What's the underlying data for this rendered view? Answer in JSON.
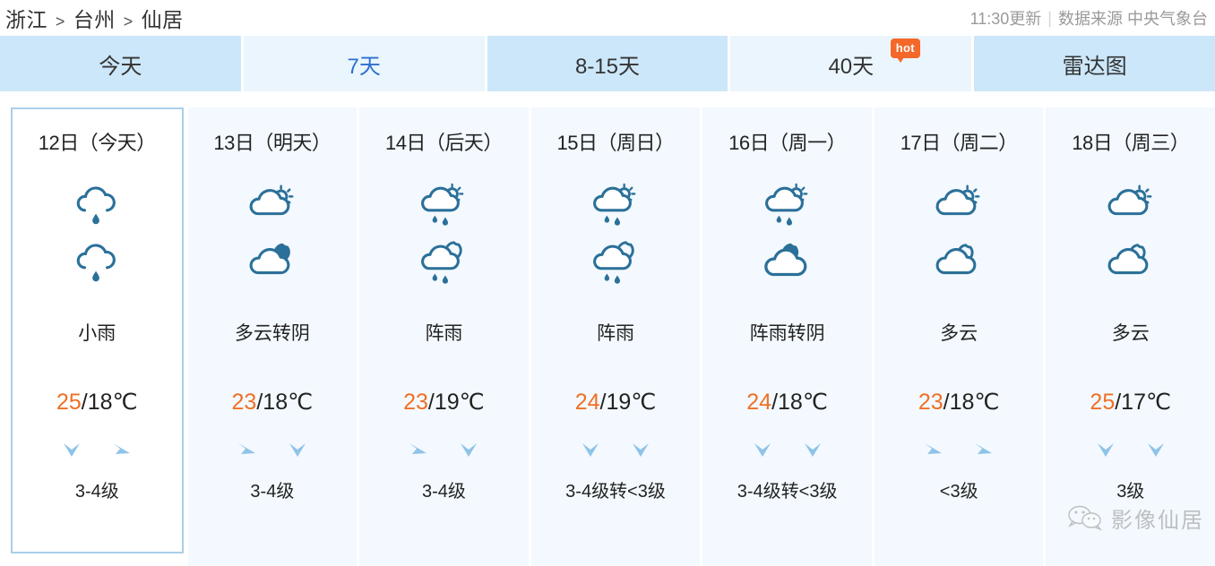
{
  "header": {
    "breadcrumb": [
      "浙江",
      "台州",
      "仙居"
    ],
    "separator": ">",
    "update_time": "11:30更新",
    "divider": "|",
    "source": "数据来源 中央气象台"
  },
  "tabs": [
    {
      "label": "今天",
      "state": "highlight"
    },
    {
      "label": "7天",
      "state": "active"
    },
    {
      "label": "8-15天",
      "state": "highlight"
    },
    {
      "label": "40天",
      "state": "highlight",
      "badge": "hot"
    },
    {
      "label": "雷达图",
      "state": "highlight"
    }
  ],
  "days": [
    {
      "date": "12日（今天）",
      "selected": true,
      "day_icon": "light-rain-icon",
      "night_icon": "light-rain-icon",
      "condition": "小雨",
      "high": "25",
      "temp_rest": "/18℃",
      "wind_icons": [
        "wind-arrow-south-icon",
        "wind-arrow-east-icon"
      ],
      "wind": "3-4级"
    },
    {
      "date": "13日（明天）",
      "selected": false,
      "day_icon": "cloudy-day-icon",
      "night_icon": "cloudy-night-icon",
      "condition": "多云转阴",
      "high": "23",
      "temp_rest": "/18℃",
      "wind_icons": [
        "wind-arrow-east-icon",
        "wind-arrow-south-icon"
      ],
      "wind": "3-4级"
    },
    {
      "date": "14日（后天）",
      "selected": false,
      "day_icon": "shower-day-icon",
      "night_icon": "shower-night-icon",
      "condition": "阵雨",
      "high": "23",
      "temp_rest": "/19℃",
      "wind_icons": [
        "wind-arrow-east-icon",
        "wind-arrow-south-icon"
      ],
      "wind": "3-4级"
    },
    {
      "date": "15日（周日）",
      "selected": false,
      "day_icon": "shower-day-icon",
      "night_icon": "shower-night-icon",
      "condition": "阵雨",
      "high": "24",
      "temp_rest": "/19℃",
      "wind_icons": [
        "wind-arrow-south-icon",
        "wind-arrow-south-icon"
      ],
      "wind": "3-4级转<3级"
    },
    {
      "date": "16日（周一）",
      "selected": false,
      "day_icon": "shower-day-icon",
      "night_icon": "overcast-night-icon",
      "condition": "阵雨转阴",
      "high": "24",
      "temp_rest": "/18℃",
      "wind_icons": [
        "wind-arrow-south-icon",
        "wind-arrow-south-icon"
      ],
      "wind": "3-4级转<3级"
    },
    {
      "date": "17日（周二）",
      "selected": false,
      "day_icon": "cloudy-day-icon",
      "night_icon": "cloudy-night-icon",
      "condition": "多云",
      "high": "23",
      "temp_rest": "/18℃",
      "wind_icons": [
        "wind-arrow-east-icon",
        "wind-arrow-east-icon"
      ],
      "wind": "<3级"
    },
    {
      "date": "18日（周三）",
      "selected": false,
      "day_icon": "cloudy-day-icon",
      "night_icon": "cloudy-night-icon",
      "condition": "多云",
      "high": "25",
      "temp_rest": "/17℃",
      "wind_icons": [
        "wind-arrow-south-icon",
        "wind-arrow-south-icon"
      ],
      "wind": "3级"
    }
  ],
  "watermark": {
    "icon": "wechat-icon",
    "text": "影像仙居"
  },
  "colors": {
    "tab_highlight": "#cce7fa",
    "tab_alt": "#eaf5fd",
    "tab_active_text": "#2e6fd0",
    "card_bg": "#f3f9fe",
    "card_selected_border": "#a9cfe9",
    "high_temp": "#ef7026",
    "icon_stroke": "#2b7099",
    "wind_arrow": "#8fc3e8",
    "badge_bg": "#f4682a"
  }
}
